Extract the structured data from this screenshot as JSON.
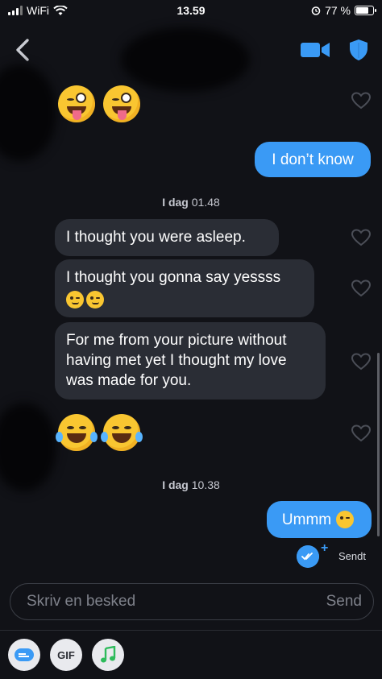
{
  "status_bar": {
    "carrier": "WiFi",
    "time": "13.59",
    "battery_text": "77 %",
    "battery_level": 0.77
  },
  "header": {
    "back_icon": "chevron-left-icon",
    "video_icon": "video-camera-icon",
    "shield_icon": "shield-icon",
    "accent_color": "#3a9af5"
  },
  "messages": {
    "m1_emoji": [
      "winking-face-with-tongue",
      "winking-face-with-tongue"
    ],
    "m2_text": "I don’t know",
    "sep1_bold": "I dag",
    "sep1_time": "01.48",
    "m3_text": "I thought you were asleep.",
    "m4_line1": "I thought you gonna say yessss",
    "m4_emoji": [
      "winking-face",
      "winking-face"
    ],
    "m5_text": "For me from your picture without having met yet I thought my love was made for you.",
    "m6_emoji": [
      "face-with-tears-of-joy",
      "face-with-tears-of-joy"
    ],
    "sep2_bold": "I dag",
    "sep2_time": "10.38",
    "m7_text": "Ummm",
    "m7_emoji": "flushed-face",
    "status_label": "Sendt"
  },
  "composer": {
    "placeholder": "Skriv en besked",
    "value": "",
    "send_label": "Send"
  },
  "toolbar": {
    "sticker_icon": "sticker-icon",
    "gif_label": "GIF",
    "music_icon": "music-note-icon"
  }
}
